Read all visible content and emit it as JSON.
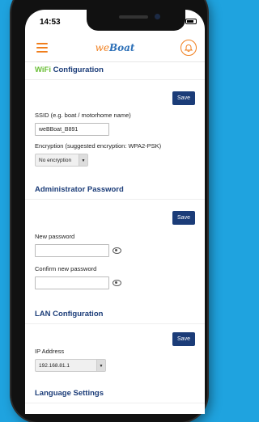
{
  "status": {
    "time": "14:53"
  },
  "header": {
    "logo_a": "we",
    "logo_b": "Boat"
  },
  "wifi": {
    "title_wifi": "WiFi",
    "title_rest": " Configuration",
    "save": "Save",
    "ssid_label": "SSID (e.g. boat / motorhome name)",
    "ssid_value": "weBBoat_B891",
    "enc_label": "Encryption (suggested encryption: WPA2-PSK)",
    "enc_value": "No encryption"
  },
  "admin": {
    "title": "Administrator Password",
    "save": "Save",
    "new_label": "New password",
    "confirm_label": "Confirm new password"
  },
  "lan": {
    "title": "LAN Configuration",
    "save": "Save",
    "ip_label": "IP Address",
    "ip_value": "192.168.81.1"
  },
  "language": {
    "title": "Language Settings"
  },
  "colors": {
    "background": "#1fa3df",
    "navy": "#1b3c78",
    "orange": "#f07e1d",
    "green": "#6abf36"
  }
}
